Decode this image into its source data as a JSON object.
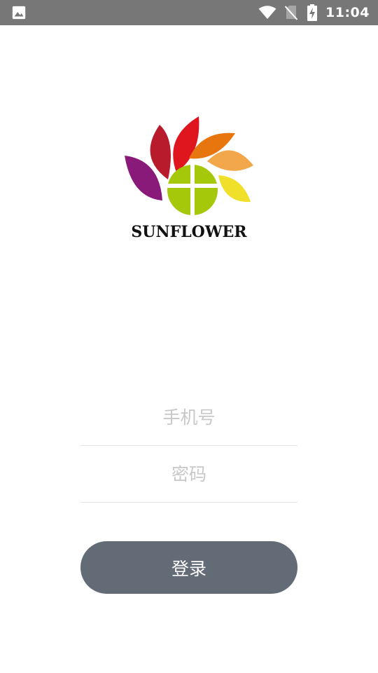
{
  "status_bar": {
    "left_icon": "image-icon",
    "icons": [
      "wifi-icon",
      "no-sim-icon",
      "battery-charging-icon"
    ],
    "time": "11:04",
    "background": "#777777"
  },
  "logo": {
    "text": "SUNFLOWER",
    "colors": [
      "#8a1a7a",
      "#b81c2c",
      "#e0161e",
      "#e8760f",
      "#f2a84a",
      "#f0e02a",
      "#a6c80a"
    ]
  },
  "form": {
    "phone_placeholder": "手机号",
    "password_placeholder": "密码",
    "login_label": "登录",
    "button_color": "#636b76"
  }
}
